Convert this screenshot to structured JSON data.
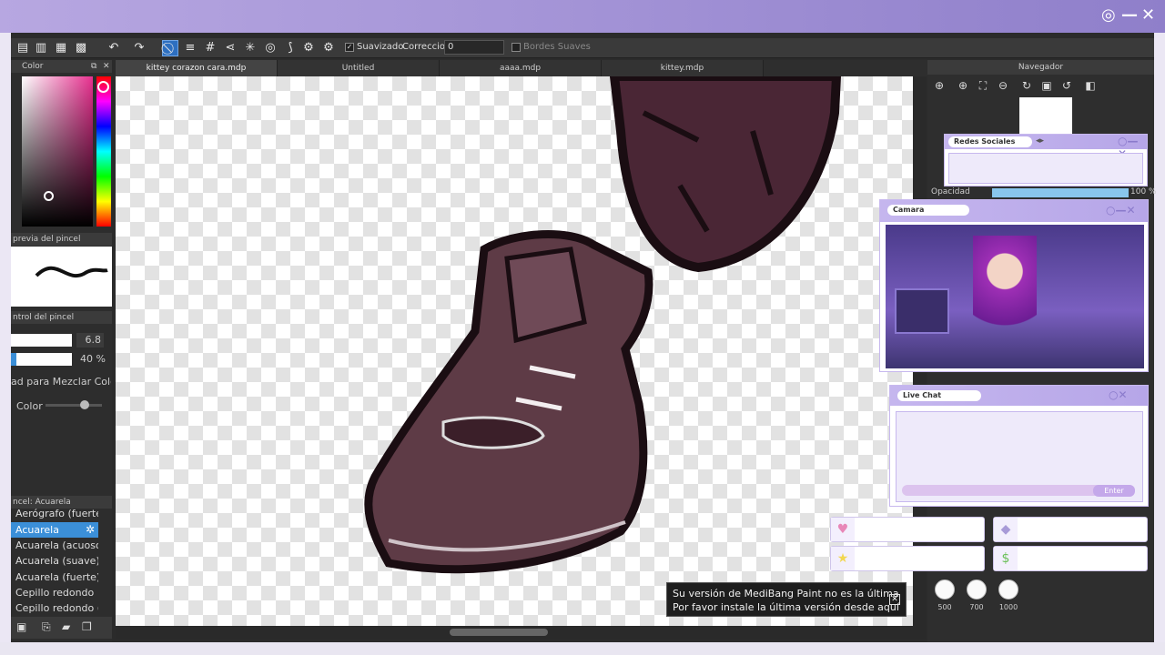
{
  "window": {
    "close_label": "✕",
    "minimize_label": "—",
    "camera_label": "◎"
  },
  "toolbar": {
    "smoothing_label": "Suavizado",
    "correction_label": "Correccion",
    "correction_value": "0",
    "soft_edges_label": "Bordes Suaves"
  },
  "tabs": [
    "kittey corazon cara.mdp",
    "Untitled",
    "aaaa.mdp",
    "kittey.mdp"
  ],
  "color_panel": {
    "title": "Color",
    "accent": "#e8308f"
  },
  "brush_preview": {
    "title": "previa del pincel"
  },
  "brush_control": {
    "title": "ntrol del pincel",
    "size_value": "6.8",
    "opacity_value": "40 %",
    "mix_label": "ad para Mezclar Colo",
    "color_label": "Color"
  },
  "brush_panel": {
    "title": "ncel: Acuarela",
    "items": [
      "Aerógrafo (fuerte",
      "Acuarela",
      "Acuarela (acuoso)",
      "Acuarela (suave)",
      "Acuarela (fuerte)",
      "Cepillo redondo",
      "Cepillo redondo (a"
    ],
    "selected": "Acuarela"
  },
  "navigator": {
    "title": "Navegador",
    "opacity_label": "Opacidad",
    "opacity_value": "100 %"
  },
  "overlay": {
    "social_title": "Redes Sociales",
    "camera_title": "Camara",
    "chat_title": "Live Chat",
    "enter_label": "Enter",
    "counts": [
      "500",
      "700",
      "1000"
    ]
  },
  "notice": {
    "line1": "Su versión de MediBang Paint no es la última",
    "line2": "Por favor instale la última versión desde aquí"
  }
}
